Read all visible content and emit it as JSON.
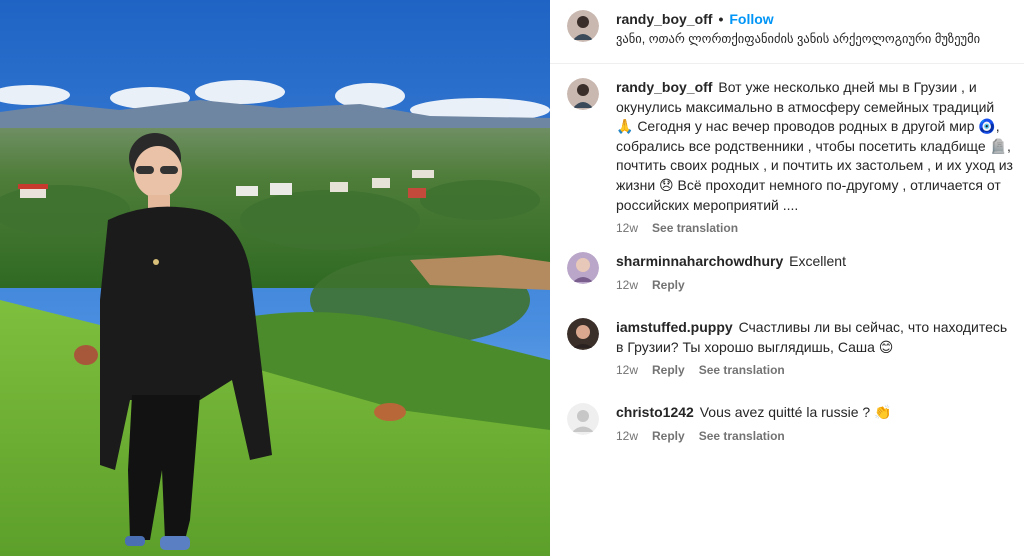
{
  "post": {
    "username": "randy_boy_off",
    "separator": "•",
    "follow_label": "Follow",
    "location": "ვანი, ოთარ ლორთქიფანიძის ვანის არქეოლოგიური მუზეუმი"
  },
  "caption": {
    "username": "randy_boy_off",
    "text": "Вот уже несколько дней мы в Грузии , и окунулись максимально в атмосферу семейных традиций 🙏 Сегодня у нас вечер проводов родных в другой мир 🧿, собрались все родственники , чтобы посетить кладбище 🪦, почтить своих родных , и почтить их застольем , и их уход из жизни 😞 Всё проходит немного по-другому , отличается от российских мероприятий ....",
    "time": "12w",
    "see_translation": "See translation"
  },
  "comments": [
    {
      "username": "sharminnaharchowdhury",
      "text": "Excellent",
      "time": "12w",
      "reply": "Reply",
      "see_translation": ""
    },
    {
      "username": "iamstuffed.puppy",
      "text": "Счастливы ли вы сейчас, что находитесь в Грузии? Ты хорошо выглядишь, Саша 😊",
      "time": "12w",
      "reply": "Reply",
      "see_translation": "See translation"
    },
    {
      "username": "christo1242",
      "text": "Vous avez quitté la russie ? 👏",
      "time": "12w",
      "reply": "Reply",
      "see_translation": "See translation"
    }
  ],
  "colors": {
    "follow": "#0095f6",
    "text": "#262626",
    "muted": "#737373"
  }
}
